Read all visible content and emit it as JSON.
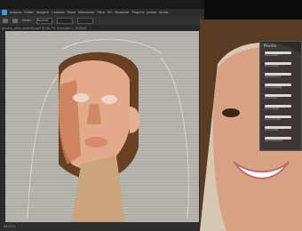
{
  "app": {
    "menu_items": [
      "Arquivo",
      "Editar",
      "Imagem",
      "Camada",
      "Texto",
      "Selecionar",
      "Filtro",
      "3D",
      "Visualizar",
      "Plug-ins",
      "Janela",
      "Ajuda"
    ],
    "options": {
      "mode_label": "Modo:",
      "mode_value": "Normal"
    },
    "document_tab": "Jessica_Alba_portrait.psd @ 66,7% (Camada 1, RGB/8)",
    "status_zoom": "66,67%"
  },
  "brush_panel": {
    "title": "Pincéis",
    "brushes": [
      "pincel sólido",
      "pincel suave",
      "pincel textura",
      "pincel aquarela",
      "pincel seco",
      "pincel de giz",
      "pincel de tinta",
      "pincel misto",
      "pincel esfumado"
    ]
  },
  "colors": {
    "ui_dark": "#2b2b2b",
    "canvas_bg": "#b8b6b0",
    "skin": "#e2a98a",
    "hair": "#6a4023"
  }
}
